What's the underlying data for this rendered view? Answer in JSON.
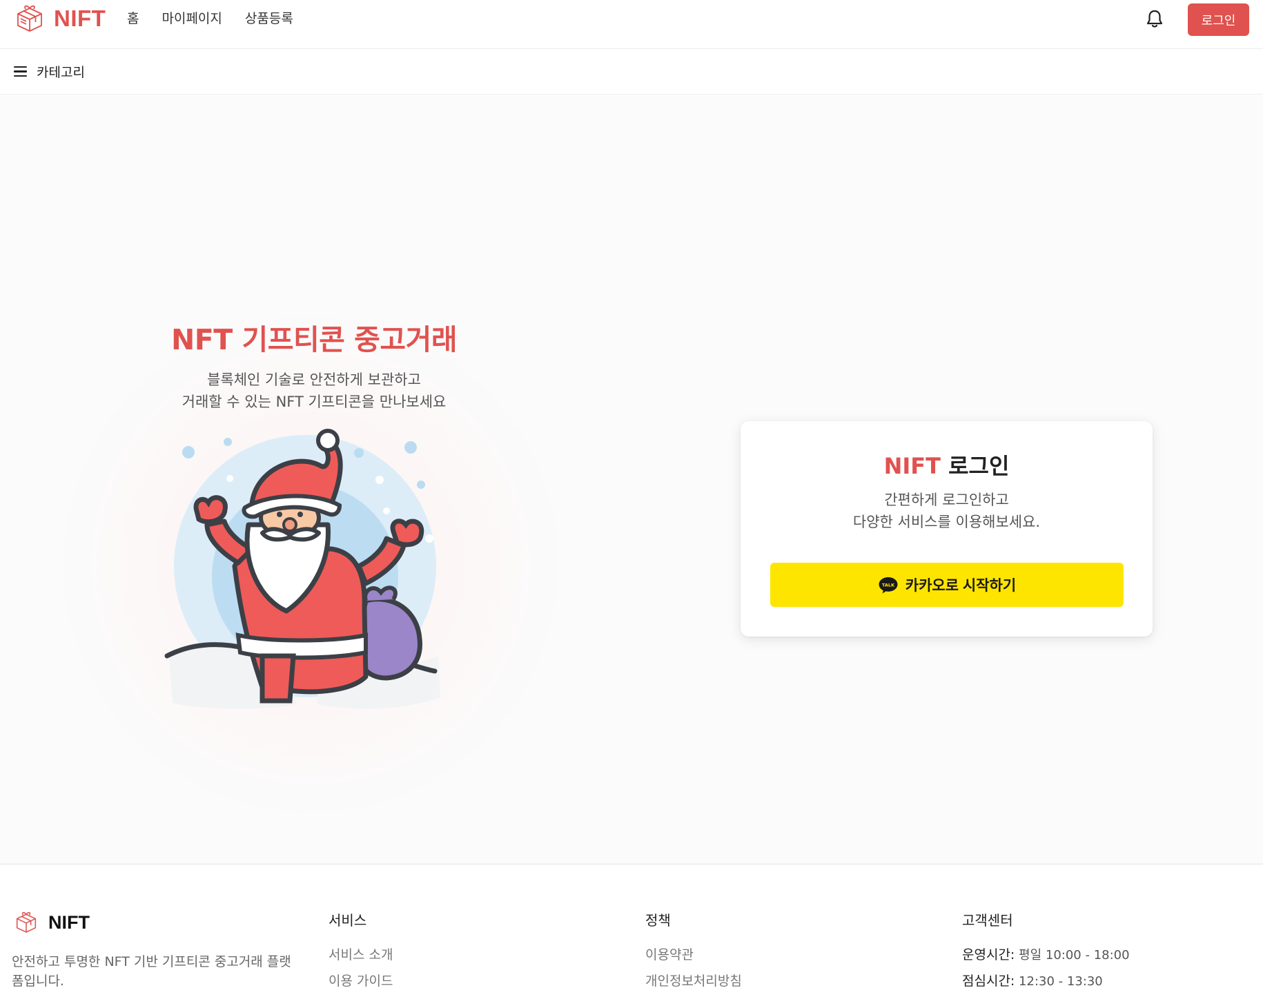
{
  "header": {
    "logo_text": "NIFT",
    "nav": [
      "홈",
      "마이페이지",
      "상품등록"
    ],
    "login_label": "로그인",
    "brand_color": "#e0524f"
  },
  "category_bar": {
    "label": "카테고리"
  },
  "hero": {
    "title": "NFT 기프티콘 중고거래",
    "subtitle_line1": "블록체인 기술로 안전하게 보관하고",
    "subtitle_line2": "거래할 수 있는 NFT 기프티콘을 만나보세요"
  },
  "login_card": {
    "title_brand": "NIFT",
    "title_rest": " 로그인",
    "subtitle_line1": "간편하게 로그인하고",
    "subtitle_line2": "다양한 서비스를 이용해보세요.",
    "kakao_button_label": "카카오로 시작하기",
    "kakao_icon_text": "TALK",
    "kakao_color": "#fee500"
  },
  "footer": {
    "logo_text": "NIFT",
    "description": "안전하고 투명한 NFT 기반 기프티콘 중고거래 플랫폼입니다.",
    "columns": {
      "service": {
        "title": "서비스",
        "links": [
          "서비스 소개",
          "이용 가이드"
        ]
      },
      "policy": {
        "title": "정책",
        "links": [
          "이용약관",
          "개인정보처리방침"
        ]
      },
      "support": {
        "title": "고객센터",
        "hours_label": "운영시간:",
        "hours_value": " 평일 10:00 - 18:00",
        "lunch_label": "점심시간:",
        "lunch_value": " 12:30 - 13:30"
      }
    }
  }
}
